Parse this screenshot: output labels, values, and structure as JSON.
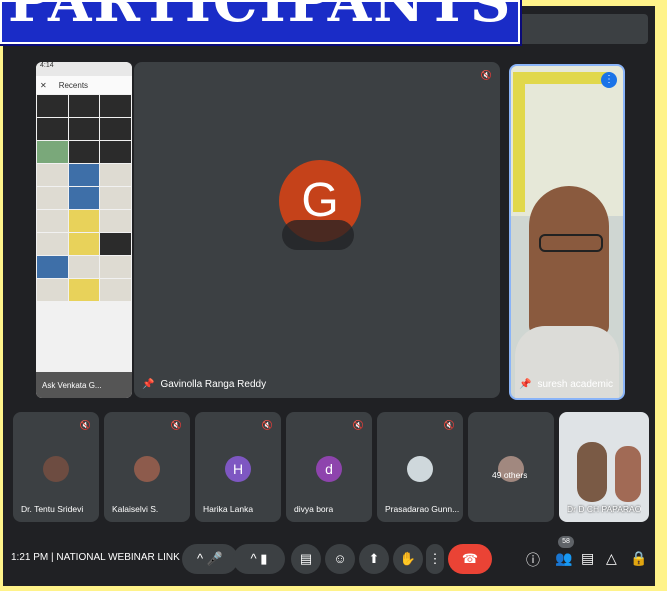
{
  "banner": {
    "title": "PARTICIPANTS"
  },
  "phone_screen": {
    "status": "4:14",
    "header": "Recents",
    "bottom_text": "Ask Venkata G..."
  },
  "main_tile": {
    "name": "Gavinolla Ranga Reddy",
    "avatar_letter": "G"
  },
  "speaker_tile": {
    "name": "suresh academic"
  },
  "participants": [
    {
      "name": "Dr. Tentu Sridevi"
    },
    {
      "name": "Kalaiselvi S."
    },
    {
      "name": "Harika Lanka",
      "letter": "H"
    },
    {
      "name": "divya bora",
      "letter": "d"
    },
    {
      "name": "Prasadarao Gunn..."
    },
    {
      "name": "49 others"
    },
    {
      "name": "Dr D CH PAPARAO"
    }
  ],
  "controls": {
    "time": "1:21 PM",
    "meeting_name": "NATIONAL WEBINAR LINK",
    "participant_count": "58"
  },
  "colors": {
    "meet_bg": "#202124",
    "tile_bg": "#3c4043",
    "leave": "#ea4335",
    "banner": "#1a2cc7",
    "accent_border": "#8ab4f8",
    "avatar_g": "#c5421a",
    "avatar_h": "#7e57c2",
    "avatar_d": "#8e44ad"
  }
}
